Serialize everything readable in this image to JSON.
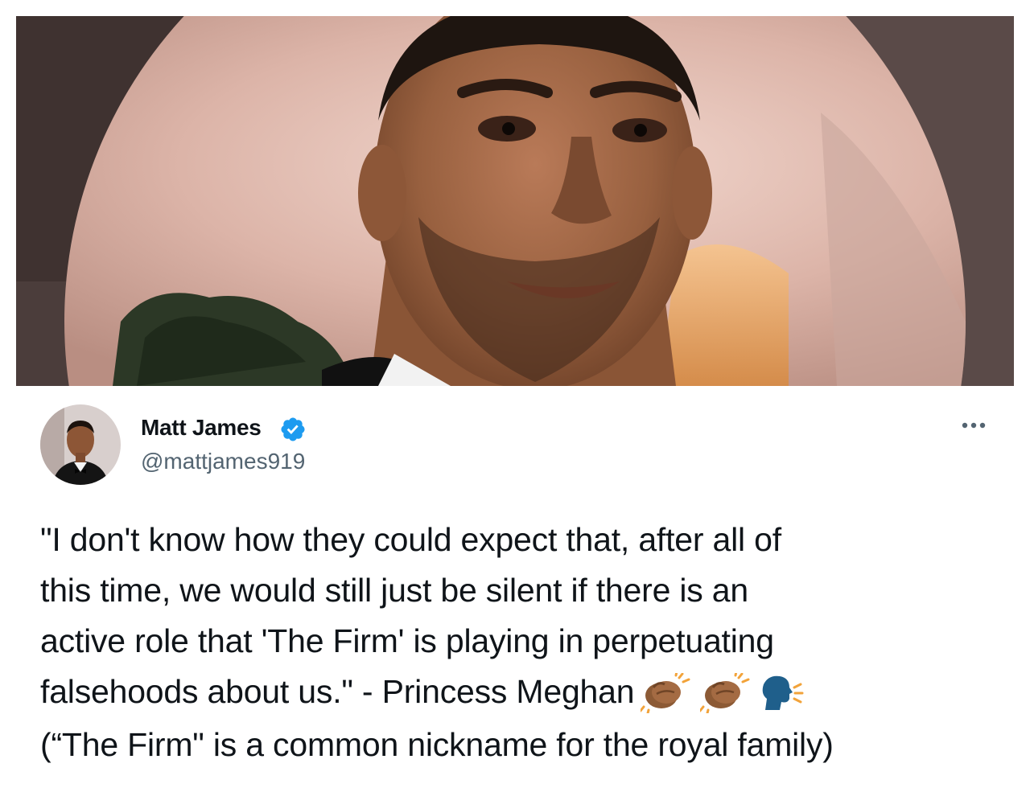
{
  "tweet": {
    "author": {
      "display_name": "Matt James",
      "handle": "@mattjames919",
      "verified": true
    },
    "more_icon": "more-horizontal-icon",
    "text_lines": [
      "\"I don't know how they could expect that, after all of",
      "this time, we would still just be silent if there is an",
      "active role that 'The Firm' is playing in perpetuating",
      "falsehoods about us.\" - Princess Meghan",
      "(“The Firm\" is a common nickname for the royal family)"
    ],
    "emojis": [
      "clapping-hands-emoji",
      "clapping-hands-emoji",
      "speaking-head-emoji"
    ]
  },
  "colors": {
    "verified_blue": "#1d9bf0",
    "text": "#0f1419",
    "secondary_text": "#536471"
  }
}
